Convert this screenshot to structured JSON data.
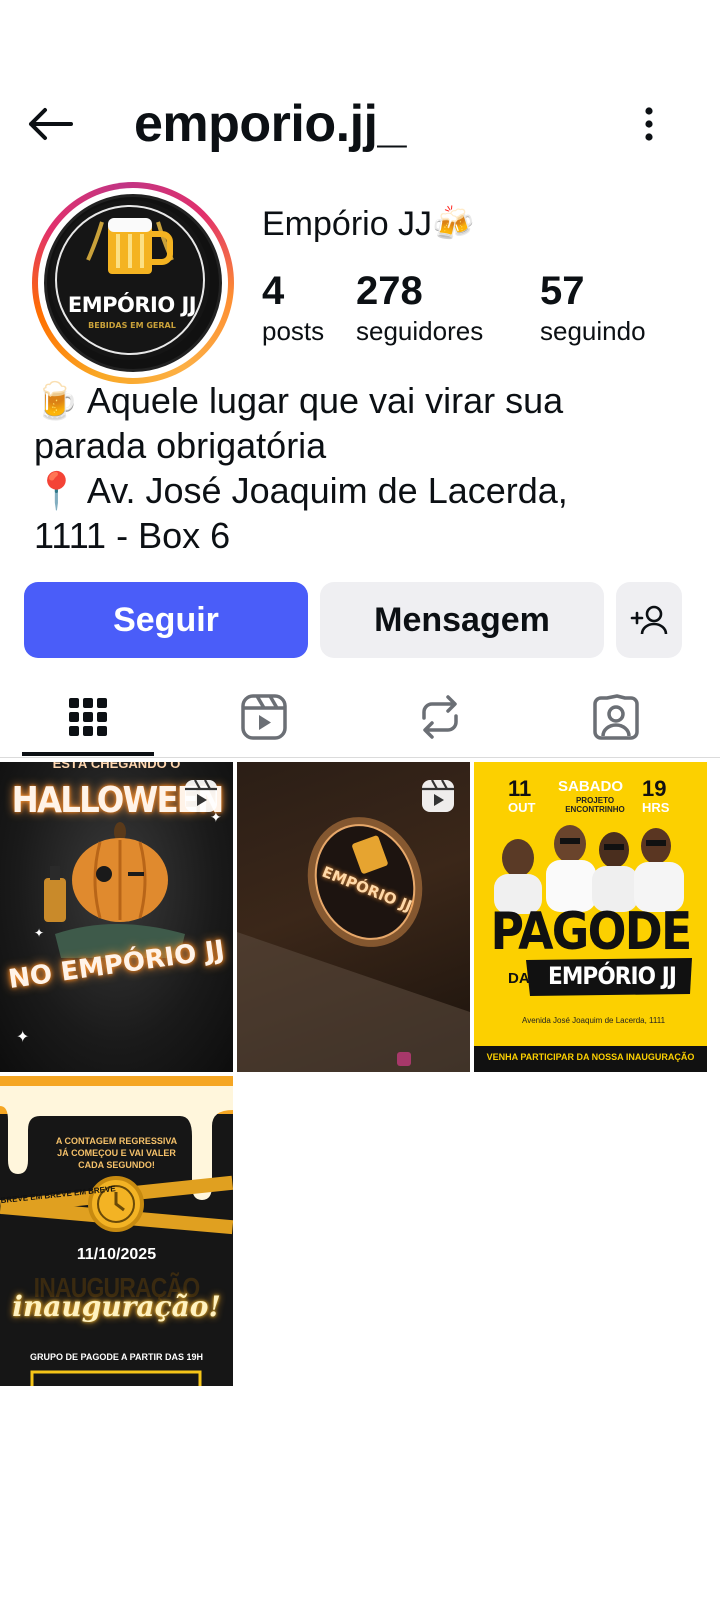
{
  "header": {
    "username": "emporio.jj_",
    "back_icon": "arrow-left-icon",
    "more_icon": "more-vertical-icon"
  },
  "profile": {
    "avatar_text": "EMPÓRIO JJ",
    "avatar_subtext": "BEBIDAS EM GERAL",
    "display_name": "Empório JJ🍻",
    "stats": {
      "posts": {
        "value": "4",
        "label": "posts"
      },
      "followers": {
        "value": "278",
        "label": "seguidores"
      },
      "following": {
        "value": "57",
        "label": "seguindo"
      }
    },
    "bio": {
      "line1": "🍺 Aquele lugar que vai virar sua",
      "line2": "parada obrigatória",
      "line3": "📍 Av. José Joaquim de Lacerda,",
      "line4": "1111 - Box 6"
    }
  },
  "actions": {
    "follow_label": "Seguir",
    "message_label": "Mensagem",
    "add_user_icon": "add-user-icon"
  },
  "tabs": [
    {
      "name": "grid",
      "icon": "grid-icon",
      "active": true
    },
    {
      "name": "reels",
      "icon": "reels-icon",
      "active": false
    },
    {
      "name": "reposts",
      "icon": "repost-icon",
      "active": false
    },
    {
      "name": "tagged",
      "icon": "tagged-icon",
      "active": false
    }
  ],
  "posts": [
    {
      "type": "reel",
      "top_text": "ESTÁ CHEGANDO O",
      "line1": "HALLOWEEN",
      "line2": "NO EMPÓRIO JJ"
    },
    {
      "type": "reel",
      "sign_text": "EMPÓRIO JJ"
    },
    {
      "type": "image",
      "day": "11",
      "month": "OUT",
      "weekday": "SABADO",
      "project": "PROJETO ENCONTRINHO",
      "hour": "19",
      "hour_unit": "HRS",
      "title": "PAGODE",
      "da": "DA",
      "brand": "EMPÓRIO JJ",
      "address": "Avenida José Joaquim de Lacerda, 1111",
      "footer": "VENHA PARTICIPAR DA NOSSA INAUGURAÇÃO"
    },
    {
      "type": "image",
      "countdown_line1": "A CONTAGEM REGRESSIVA",
      "countdown_line2": "JÁ COMEÇOU E VAI VALER",
      "countdown_line3": "CADA SEGUNDO!",
      "tape": "BREVE EM BREVE EM BREVE",
      "date": "11/10/2025",
      "big": "INAUGURAÇÃO",
      "script": "inauguração!",
      "footer": "GRUPO DE PAGODE A PARTIR DAS 19H"
    }
  ],
  "colors": {
    "primary_button": "#4a5df9",
    "secondary_button": "#efeff2",
    "text": "#0c1014",
    "poster_yellow": "#fcd000"
  }
}
